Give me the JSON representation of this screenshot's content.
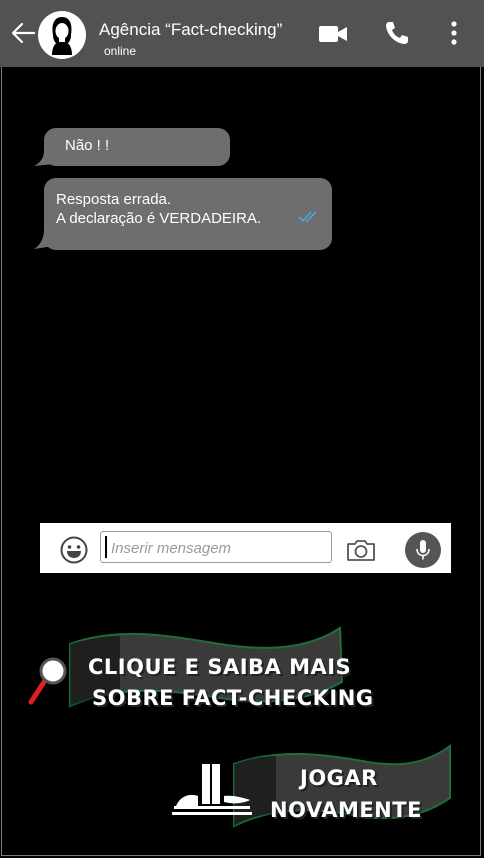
{
  "header": {
    "contact_name": "Agência “Fact-checking”",
    "status": "online",
    "icons": [
      "back-arrow-icon",
      "avatar-icon",
      "video-camera-icon",
      "phone-icon",
      "more-vert-icon"
    ]
  },
  "messages": [
    {
      "text": "Não ! !"
    },
    {
      "line1": "Resposta errada.",
      "line2": "A  declaração é VERDADEIRA."
    }
  ],
  "composer": {
    "placeholder": "Inserir mensagem",
    "icons": [
      "emoji-icon",
      "camera-icon",
      "mic-icon"
    ]
  },
  "learn_more": {
    "line1": "CLIQUE E SAIBA MAIS",
    "line2": "SOBRE FACT-CHECKING",
    "icon": "magnifier-icon"
  },
  "play_again": {
    "line1": "JOGAR",
    "line2": "NOVAMENTE",
    "icon": "congress-building-icon"
  },
  "colors": {
    "header_bg": "#525252",
    "bubble_bg": "#6e6e6e",
    "tick_color": "#4aa8d8",
    "banner_fill": "#3a3a3a",
    "banner_border": "#1f6e3a",
    "magnifier_handle": "#e02020"
  }
}
